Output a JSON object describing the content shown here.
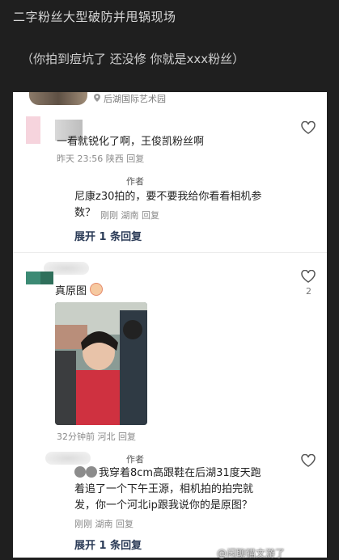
{
  "post": {
    "title": "二字粉丝大型破防并甩锅现场",
    "subtitle": "（你拍到痘坑了 还没修 你就是xxx粉丝）"
  },
  "location": {
    "text": "后湖国际艺术园"
  },
  "comments": [
    {
      "text": "一看就锐化了啊，王俊凯粉丝啊",
      "meta": "昨天 23:56 陕西 回复",
      "reply": {
        "author_tag": "作者",
        "text_line1": "尼康z30拍的，要不要我给你看看相机参",
        "text_line2": "数？",
        "meta": "刚刚  湖南 回复"
      },
      "expand": "展开 1 条回复"
    },
    {
      "text": "真原图",
      "like_count": "2",
      "meta": "32分钟前  河北 回复",
      "reply": {
        "author_tag": "作者",
        "text_line1": "我穿着8cm高跟鞋在后湖31度天跑",
        "text_line2": "着追了一个下午王源，相机拍的拍完就",
        "text_line3": "发，你一个河北ip跟我说你的是原图？",
        "meta": "刚刚  湖南 回复"
      },
      "expand": "展开 1 条回复"
    }
  ],
  "watermark": "@闲聊猫文游了",
  "colors": {
    "accent_blue": "#2b3b57",
    "bg_dark": "#1f1f1f"
  }
}
